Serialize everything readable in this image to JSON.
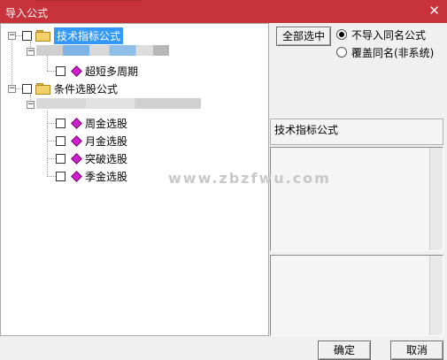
{
  "window": {
    "title": "导入公式",
    "close_icon": "close-icon"
  },
  "tree": {
    "groups": [
      {
        "label": "技术指标公式",
        "selected": true,
        "items": [
          {
            "label": "超短多周期"
          }
        ]
      },
      {
        "label": "条件选股公式",
        "selected": false,
        "items": [
          {
            "label": "周金选股"
          },
          {
            "label": "月金选股"
          },
          {
            "label": "突破选股"
          },
          {
            "label": "季金选股"
          }
        ]
      }
    ]
  },
  "controls": {
    "select_all_label": "全部选中",
    "radio_options": [
      {
        "label": "不导入同名公式",
        "checked": true
      },
      {
        "label": "覆盖同名(非系统)",
        "checked": false
      }
    ]
  },
  "info_panel": {
    "text": "技术指标公式"
  },
  "footer": {
    "ok_label": "确定",
    "cancel_label": "取消"
  },
  "watermark": "www.zbzfwu.com",
  "colors": {
    "titlebar": "#c8323a",
    "selection": "#3399ff",
    "formula_icon": "#d11fcf"
  }
}
